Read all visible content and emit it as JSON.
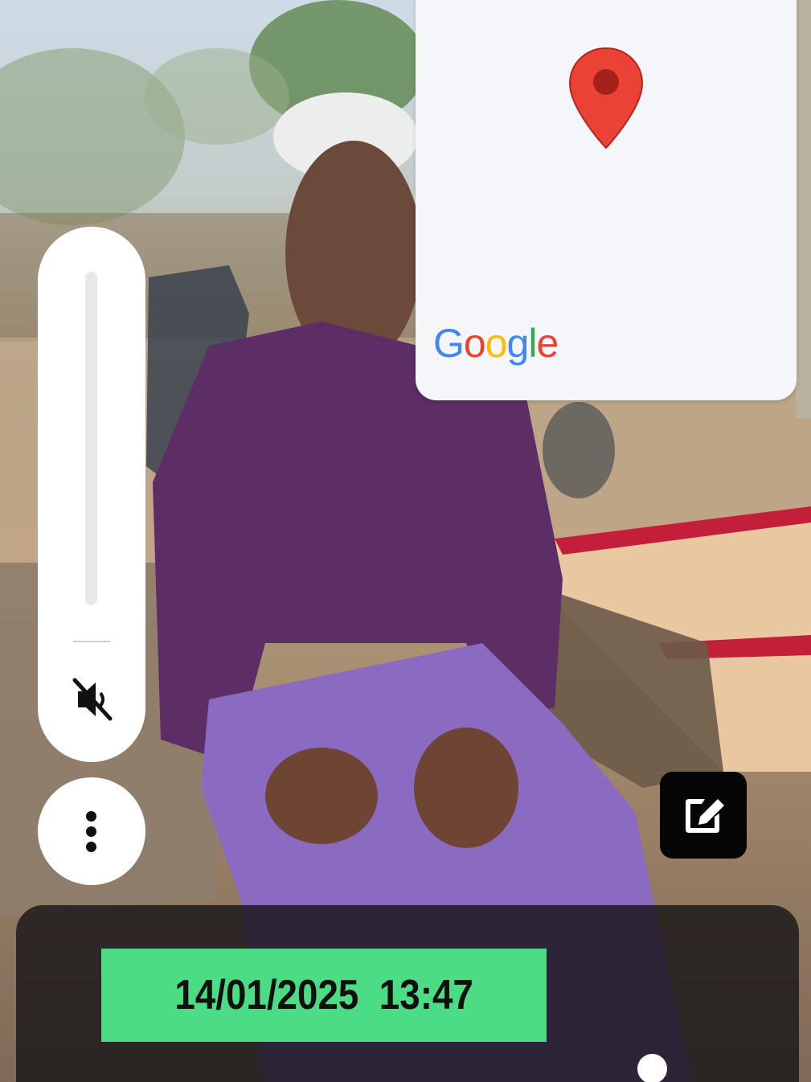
{
  "map": {
    "brand_logo": "Google",
    "pin_icon": "map-pin-icon",
    "pin_color": "#ea4335"
  },
  "volume": {
    "level": 0,
    "mute_icon": "volume-mute-icon"
  },
  "more_menu": {
    "icon": "more-vertical-icon"
  },
  "edit": {
    "icon": "edit-icon"
  },
  "timestamp": {
    "date": "14/01/2025",
    "time": "13:47",
    "background": "#4ddc86"
  },
  "pager": {
    "current_indicator_icon": "page-indicator-dot"
  }
}
